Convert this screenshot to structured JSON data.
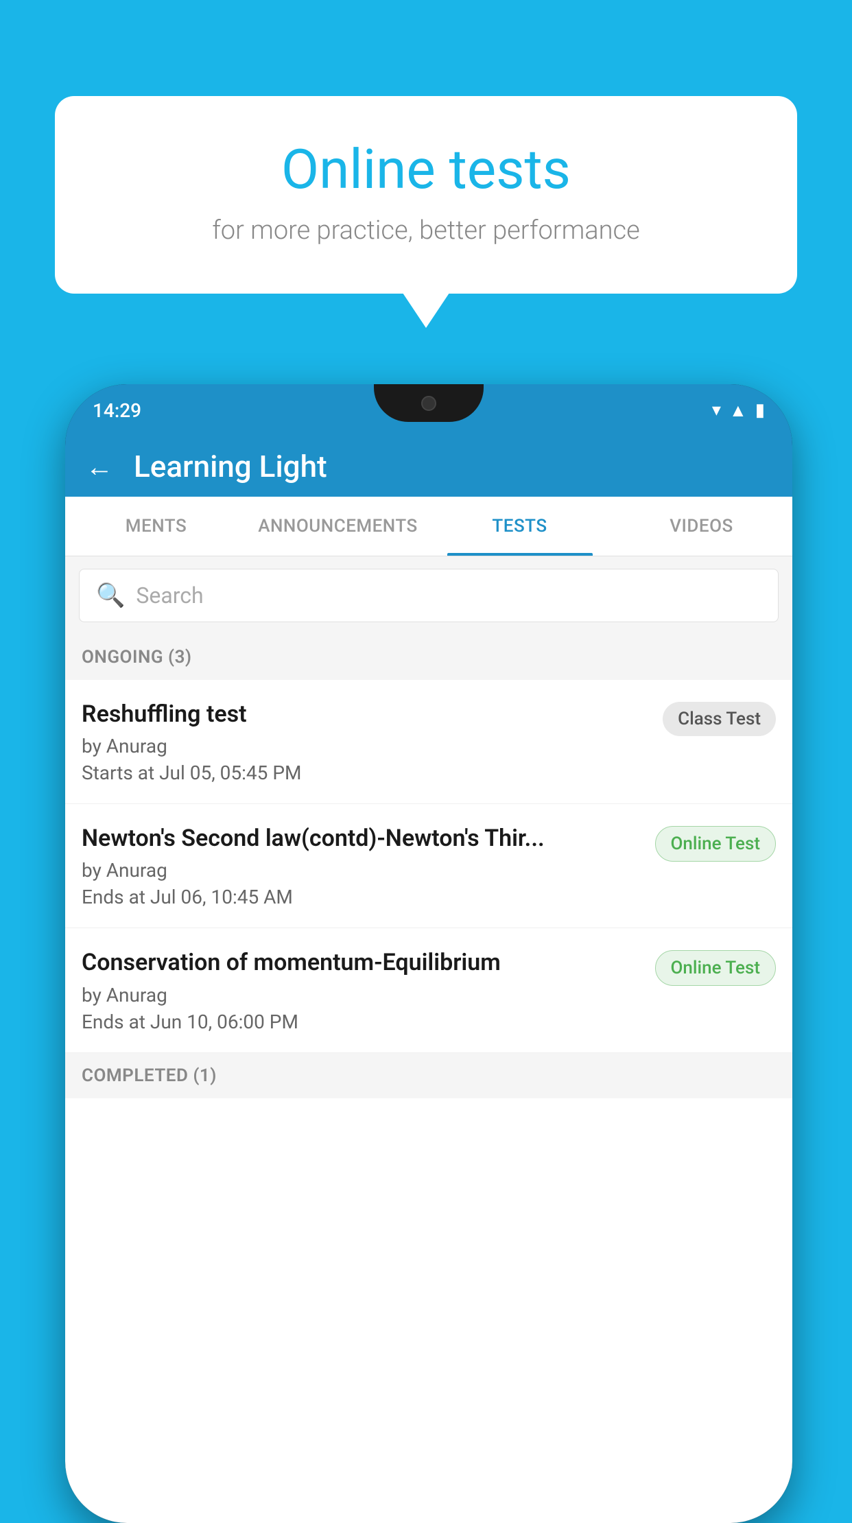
{
  "background_color": "#1ab5e8",
  "speech_bubble": {
    "title": "Online tests",
    "subtitle": "for more practice, better performance"
  },
  "phone": {
    "status_bar": {
      "time": "14:29",
      "icons": [
        "wifi",
        "signal",
        "battery"
      ]
    },
    "app_header": {
      "title": "Learning Light",
      "back_label": "←"
    },
    "tabs": [
      {
        "id": "ments",
        "label": "MENTS",
        "active": false
      },
      {
        "id": "announcements",
        "label": "ANNOUNCEMENTS",
        "active": false
      },
      {
        "id": "tests",
        "label": "TESTS",
        "active": true
      },
      {
        "id": "videos",
        "label": "VIDEOS",
        "active": false
      }
    ],
    "search": {
      "placeholder": "Search"
    },
    "ongoing_section": {
      "label": "ONGOING (3)",
      "items": [
        {
          "name": "Reshuffling test",
          "by": "by Anurag",
          "time": "Starts at  Jul 05, 05:45 PM",
          "badge": "Class Test",
          "badge_type": "class"
        },
        {
          "name": "Newton's Second law(contd)-Newton's Thir...",
          "by": "by Anurag",
          "time": "Ends at  Jul 06, 10:45 AM",
          "badge": "Online Test",
          "badge_type": "online"
        },
        {
          "name": "Conservation of momentum-Equilibrium",
          "by": "by Anurag",
          "time": "Ends at  Jun 10, 06:00 PM",
          "badge": "Online Test",
          "badge_type": "online"
        }
      ]
    },
    "completed_section": {
      "label": "COMPLETED (1)"
    }
  }
}
